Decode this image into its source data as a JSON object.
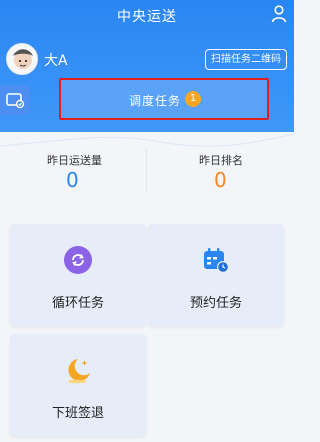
{
  "header": {
    "title": "中央运送"
  },
  "user": {
    "name": "大A",
    "scan_button": "扫描任务二维码"
  },
  "task": {
    "label": "调度任务",
    "badge": "1"
  },
  "stats": {
    "left": {
      "label": "昨日运送量",
      "value": "0",
      "color": "#2a86f3"
    },
    "right": {
      "label": "昨日排名",
      "value": "0",
      "color": "#f08a24"
    }
  },
  "menu": [
    {
      "label": "循环任务",
      "icon": "cycle-icon",
      "color": "#8a63e6"
    },
    {
      "label": "预约任务",
      "icon": "calendar-icon",
      "color": "#2a86f3"
    },
    {
      "label": "下班签退",
      "icon": "moon-icon",
      "color": "#f5a623"
    }
  ]
}
